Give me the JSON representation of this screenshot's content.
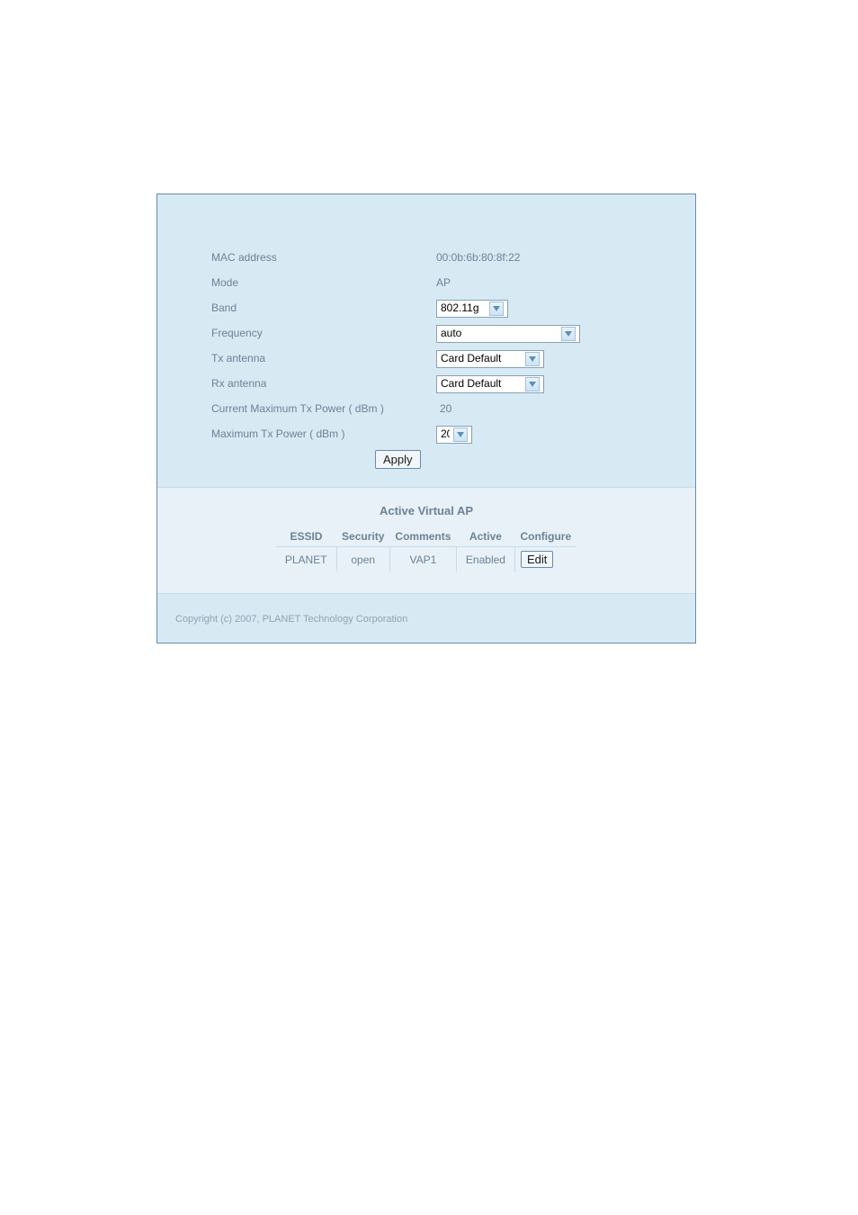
{
  "form": {
    "mac_label": "MAC address",
    "mac_value": "00:0b:6b:80:8f:22",
    "mode_label": "Mode",
    "mode_value": "AP",
    "band_label": "Band",
    "band_value": "802.11g",
    "freq_label": "Frequency",
    "freq_value": "auto",
    "txant_label": "Tx antenna",
    "txant_value": "Card Default",
    "rxant_label": "Rx antenna",
    "rxant_value": "Card Default",
    "curmax_label": "Current Maximum Tx Power ( dBm )",
    "curmax_value": "20",
    "maxpow_label": "Maximum Tx Power ( dBm )",
    "maxpow_value": "20",
    "apply_label": "Apply"
  },
  "vap": {
    "title": "Active Virtual AP",
    "headers": {
      "essid": "ESSID",
      "security": "Security",
      "comments": "Comments",
      "active": "Active",
      "configure": "Configure"
    },
    "rows": [
      {
        "essid": "PLANET",
        "security": "open",
        "comments": "VAP1",
        "active": "Enabled",
        "edit_label": "Edit"
      }
    ]
  },
  "copyright": "Copyright (c) 2007, PLANET Technology Corporation"
}
